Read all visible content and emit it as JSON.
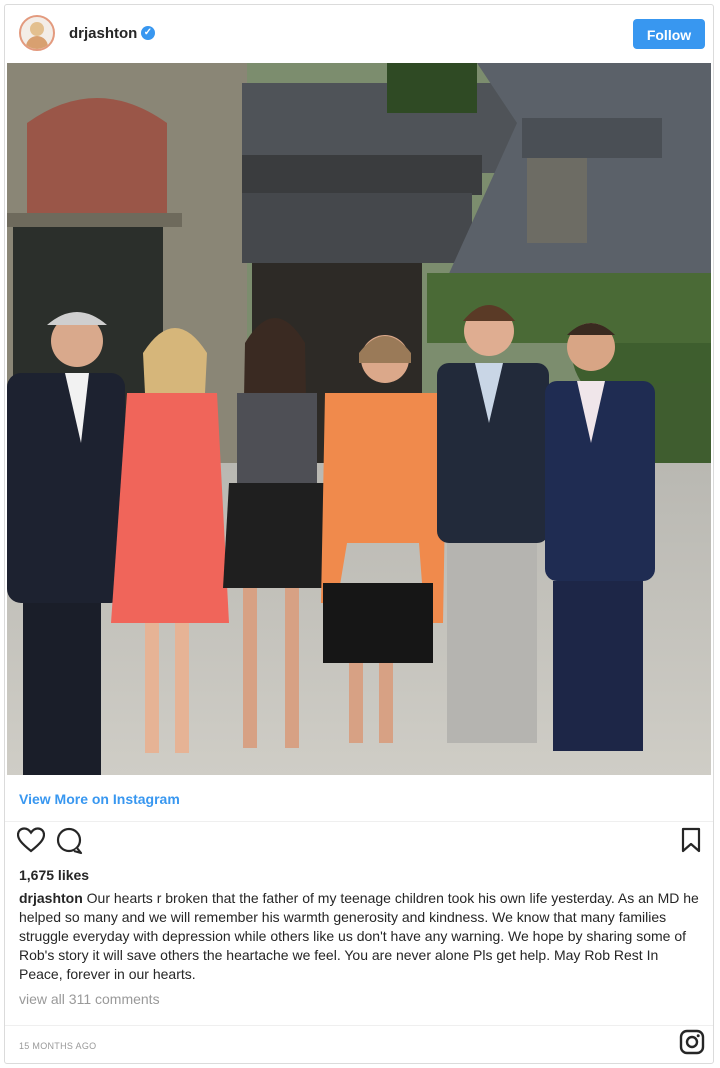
{
  "post": {
    "username": "drjashton",
    "verified_symbol": "✓",
    "follow_label": "Follow",
    "image_alt": "",
    "view_more_label": "View More on Instagram",
    "likes": "1,675 likes",
    "caption_user": "drjashton",
    "caption_text": "Our hearts r broken that the father of my teenage children took his own life yesterday. As an MD he helped so many and we will remember his warmth generosity and kindness. We know that many families struggle everyday with depression while others like us don't have any warning. We hope by sharing some of Rob's story it will save others the heartache we feel. You are never alone Pls get help. May Rob Rest In Peace, forever in our hearts.",
    "comments_label": "view all 311 comments",
    "time_ago": "15 MONTHS AGO"
  },
  "icons": {
    "heart": "heart-icon",
    "comment": "comment-icon",
    "bookmark": "bookmark-icon",
    "instagram": "instagram-logo-icon"
  },
  "colors": {
    "accent": "#3897f0",
    "text": "#262626",
    "muted": "#999999"
  }
}
